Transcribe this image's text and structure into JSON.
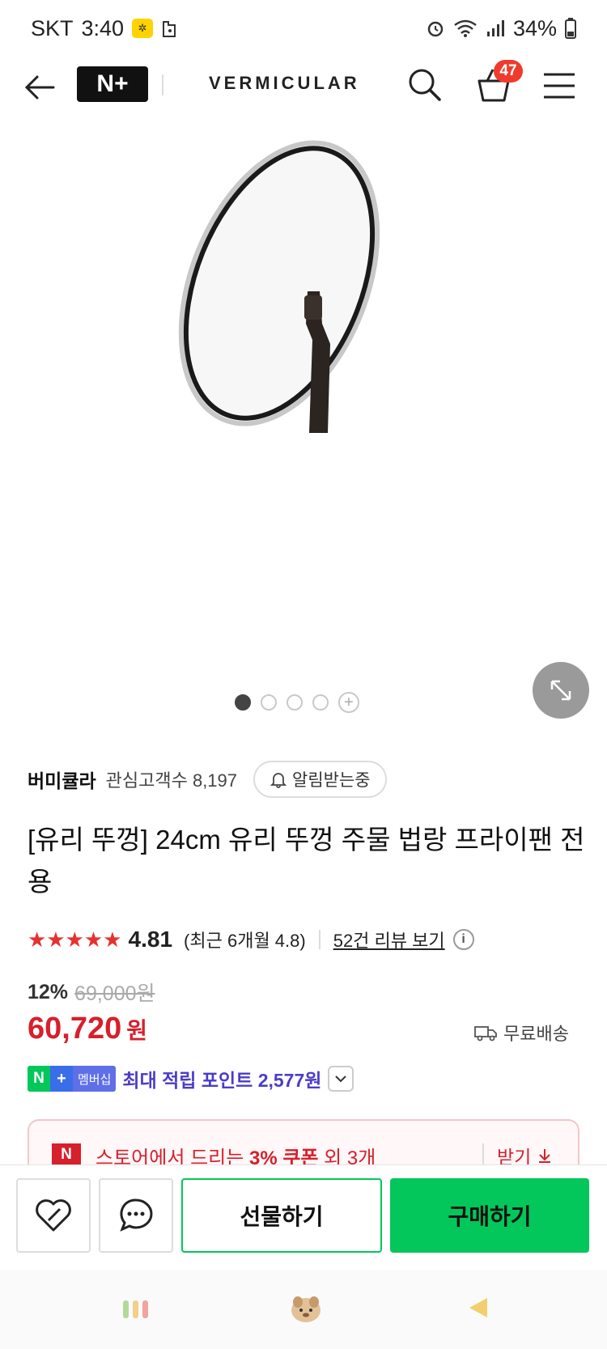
{
  "status_bar": {
    "carrier": "SKT",
    "time": "3:40",
    "battery": "34%"
  },
  "nav": {
    "brand": "VERMICULAR",
    "cart_count": "47",
    "logo_text": "N+"
  },
  "product": {
    "seller": "버미큘라",
    "followers_label": "관심고객수 8,197",
    "notify_label": "알림받는중",
    "title": "[유리 뚜껑] 24cm 유리 뚜껑 주물 법랑 프라이팬 전용",
    "rating": "4.81",
    "recent_rating": "(최근 6개월 4.8)",
    "review_link": "52건 리뷰 보기",
    "discount_rate": "12%",
    "original_price": "69,000원",
    "sale_price": "60,720",
    "price_unit": "원",
    "shipping": "무료배송",
    "membership_badge": "멤버십",
    "membership_points": "최대 적립 포인트 2,577원"
  },
  "coupon": {
    "prefix": "스토어에서 드리는 ",
    "highlight": "3% 쿠폰",
    "suffix": " 외 3개",
    "action": "받기"
  },
  "actions": {
    "gift": "선물하기",
    "buy": "구매하기"
  },
  "carousel": {
    "total": 4,
    "active": 1
  },
  "colors": {
    "naver_green": "#03c75a",
    "sale_red": "#d6202c",
    "star_red": "#e5322e",
    "membership_purple": "#4a3dc8"
  }
}
